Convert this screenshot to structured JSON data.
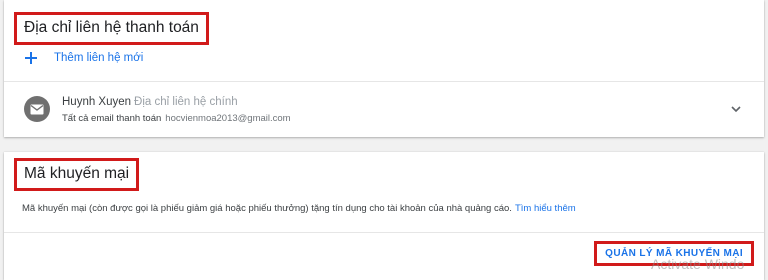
{
  "billing_contact": {
    "title": "Địa chỉ liên hệ thanh toán",
    "add_label": "Thêm liên hệ mới",
    "contact": {
      "name": "Huynh Xuyen",
      "tag": "Địa chỉ liên hệ chính",
      "sub_label": "Tất cả email thanh toán",
      "email": "hocvienmoa2013@gmail.com"
    }
  },
  "promo": {
    "title": "Mã khuyến mại",
    "description": "Mã khuyến mại (còn được gọi là phiếu giảm giá hoặc phiếu thưởng) tặng tín dụng cho tài khoản của nhà quảng cáo.",
    "learn_more": "Tìm hiểu thêm",
    "manage_button": "QUẢN LÝ MÃ KHUYẾN MẠI"
  },
  "watermark": "Activate Windo",
  "icons": {
    "add": "plus-icon",
    "avatar": "mail-icon",
    "expand": "chevron-down-icon"
  },
  "colors": {
    "accent": "#1a73e8",
    "highlight_border": "#d11a1a",
    "avatar_bg": "#707070"
  }
}
